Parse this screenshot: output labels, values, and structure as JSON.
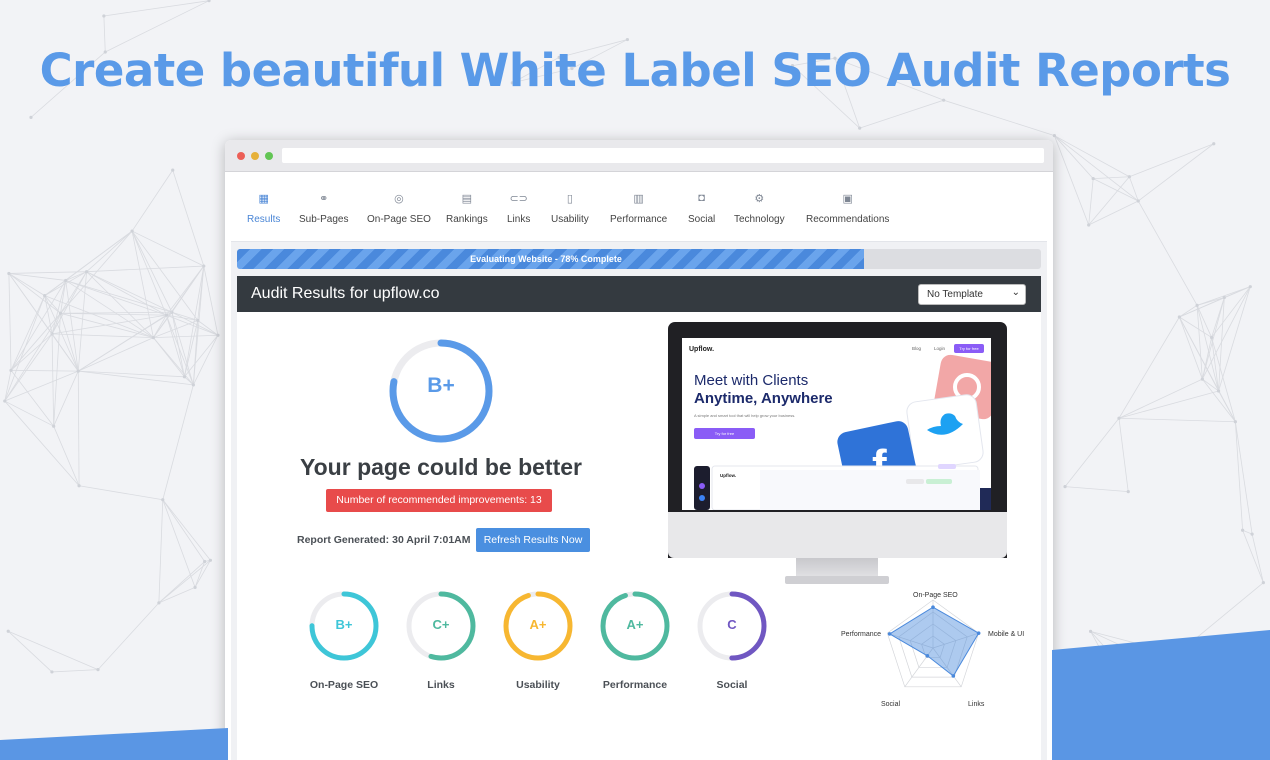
{
  "headline": "Create beautiful White Label SEO Audit Reports",
  "tabs": [
    {
      "label": "Results",
      "icon": "dashboard-icon"
    },
    {
      "label": "Sub-Pages",
      "icon": "nodes-icon"
    },
    {
      "label": "On-Page SEO",
      "icon": "target-icon"
    },
    {
      "label": "Rankings",
      "icon": "ranking-chart-icon"
    },
    {
      "label": "Links",
      "icon": "link-icon"
    },
    {
      "label": "Usability",
      "icon": "tablet-icon"
    },
    {
      "label": "Performance",
      "icon": "bar-chart-icon"
    },
    {
      "label": "Social",
      "icon": "social-folder-icon"
    },
    {
      "label": "Technology",
      "icon": "gears-icon"
    },
    {
      "label": "Recommendations",
      "icon": "clipboard-icon"
    }
  ],
  "progress": {
    "label": "Evaluating Website - 78% Complete",
    "percent": 78
  },
  "audit": {
    "title": "Audit Results for upflow.co",
    "template_select": "No Template",
    "overall_grade": "B+",
    "overall_score": 0.78,
    "verdict": "Your page could be better",
    "improvements": "Number of recommended improvements: 13",
    "report_generated": "Report Generated: 30 April 7:01AM",
    "refresh_label": "Refresh Results Now"
  },
  "preview": {
    "logo": "Upflow.",
    "nav": [
      "Blog",
      "Login"
    ],
    "cta": "Try for free",
    "hero_line1": "Meet with Clients",
    "hero_line2": "Anytime, Anywhere",
    "hero_sub": "A simple and smart tool that will help grow your business.",
    "hero_button": "Try for free"
  },
  "scores": [
    {
      "label": "On-Page SEO",
      "grade": "B+",
      "fraction": 0.75,
      "color": "#3ec6d8"
    },
    {
      "label": "Links",
      "grade": "C+",
      "fraction": 0.55,
      "color": "#4fb99f"
    },
    {
      "label": "Usability",
      "grade": "A+",
      "fraction": 0.95,
      "color": "#f7b731"
    },
    {
      "label": "Performance",
      "grade": "A+",
      "fraction": 0.95,
      "color": "#4fb99f"
    },
    {
      "label": "Social",
      "grade": "C",
      "fraction": 0.5,
      "color": "#7057c2"
    }
  ],
  "radar": {
    "axes": [
      "On-Page SEO",
      "Mobile & UI",
      "Links",
      "Social",
      "Performance"
    ],
    "values": [
      0.85,
      1.0,
      0.72,
      0.2,
      0.95
    ]
  }
}
